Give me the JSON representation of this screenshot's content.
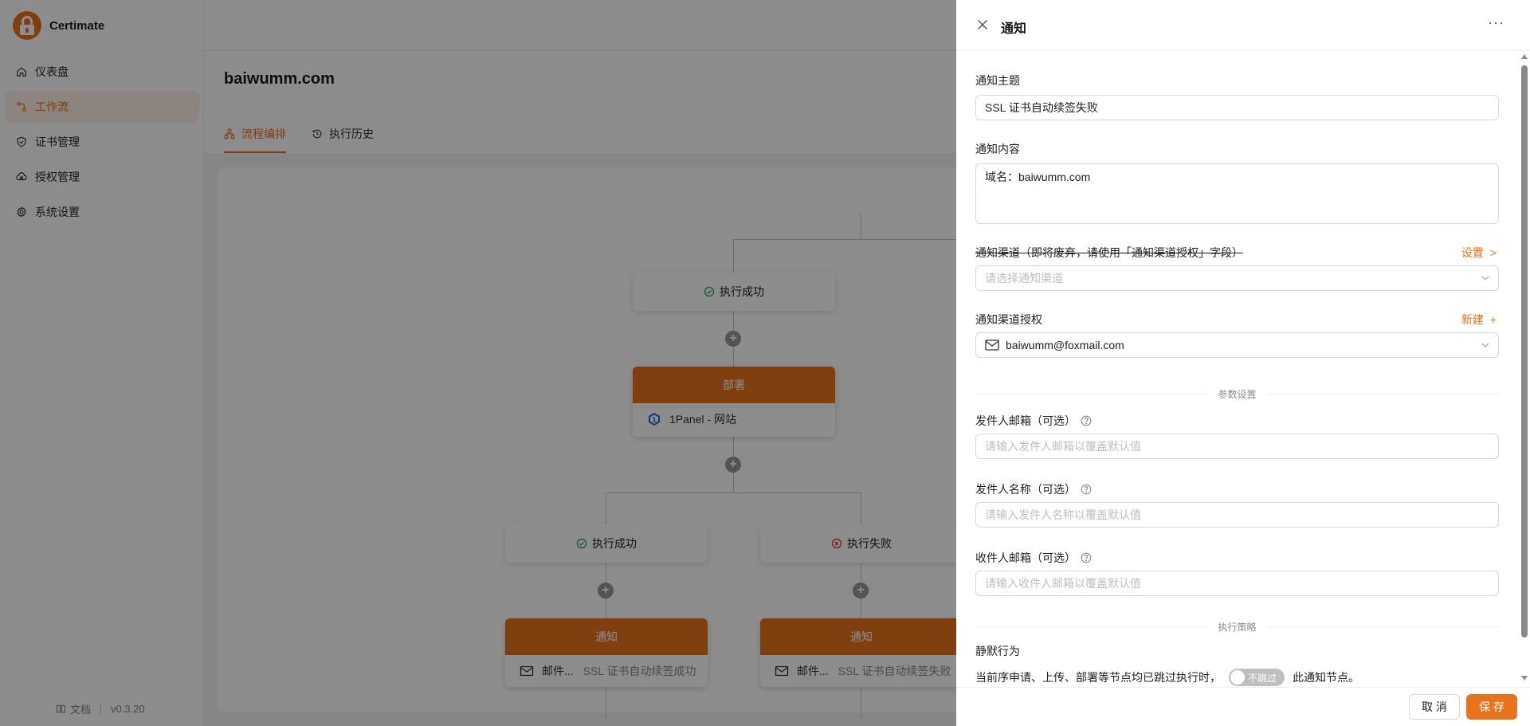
{
  "app": {
    "name": "Certimate",
    "accent_color": "#e8731a",
    "version": "v0.3.20",
    "docs_label": "文档"
  },
  "sidebar": {
    "items": [
      {
        "label": "仪表盘",
        "icon": "home-icon",
        "active": false
      },
      {
        "label": "工作流",
        "icon": "workflow-icon",
        "active": true
      },
      {
        "label": "证书管理",
        "icon": "shield-check-icon",
        "active": false
      },
      {
        "label": "授权管理",
        "icon": "cloud-lock-icon",
        "active": false
      },
      {
        "label": "系统设置",
        "icon": "gear-icon",
        "active": false
      }
    ]
  },
  "main": {
    "title": "baiwumm.com",
    "tabs": [
      {
        "label": "流程编排",
        "icon": "flow-icon",
        "active": true
      },
      {
        "label": "执行历史",
        "icon": "history-icon",
        "active": false
      }
    ]
  },
  "workflow": {
    "branch_success": "执行成功",
    "branch_fail": "执行失败",
    "deploy_node": {
      "title": "部署",
      "body": "1Panel - 网站"
    },
    "notify_success": {
      "title": "通知",
      "body": "邮件...",
      "sub": "SSL 证书自动续签成功"
    },
    "notify_fail": {
      "title": "通知",
      "body": "邮件...",
      "sub": "SSL 证书自动续签失败"
    }
  },
  "drawer": {
    "title": "通知",
    "more_icon": "ellipsis-icon",
    "subject_label": "通知主题",
    "subject_value": "SSL 证书自动续签失败",
    "content_label": "通知内容",
    "content_value": "域名：baiwumm.com",
    "channel_label": "通知渠道（即将废弃，请使用「通知渠道授权」字段）",
    "channel_action": "设置",
    "channel_action_symbol": ">",
    "channel_placeholder": "请选择通知渠道",
    "access_label": "通知渠道授权",
    "access_action": "新建",
    "access_action_symbol": "+",
    "access_value": "baiwumm@foxmail.com",
    "params_divider": "参数设置",
    "sender_email_label": "发件人邮箱（可选）",
    "sender_email_placeholder": "请输入发件人邮箱以覆盖默认值",
    "sender_name_label": "发件人名称（可选）",
    "sender_name_placeholder": "请输入发件人名称以覆盖默认值",
    "receiver_email_label": "收件人邮箱（可选）",
    "receiver_email_placeholder": "请输入收件人邮箱以覆盖默认值",
    "strategy_divider": "执行策略",
    "silent_label": "静默行为",
    "silent_prefix": "当前序申请、上传、部署等节点均已跳过执行时，",
    "silent_switch": "不跳过",
    "silent_suffix": "此通知节点。",
    "cancel_label": "取 消",
    "save_label": "保 存"
  }
}
